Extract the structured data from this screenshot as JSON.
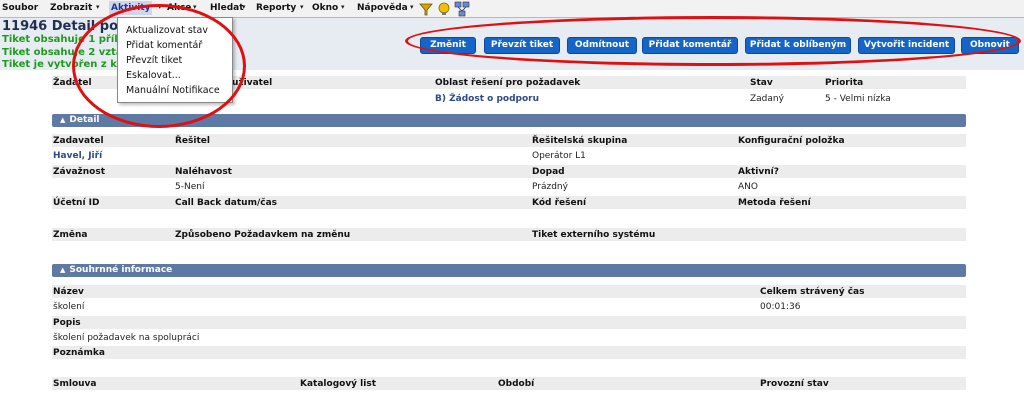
{
  "menu": {
    "items": [
      "Soubor",
      "Zobrazit",
      "Aktivity",
      "Akce",
      "Hledat",
      "Reporty",
      "Okno",
      "Nápověda"
    ]
  },
  "toolbar_icons": [
    "filter-icon",
    "lightbulb-icon",
    "network-icon"
  ],
  "header": {
    "title": "11946 Detail poža",
    "messages": [
      "Tiket obsahuje 1 přílo",
      "Tiket obsahuje 2 vzta",
      "Tiket je vytvořen z ko"
    ]
  },
  "actions": [
    "Změnit",
    "Převzít tiket",
    "Odmítnout",
    "Přidat komentář",
    "Přidat k oblíbeným",
    "Vytvořit incident",
    "Obnovit"
  ],
  "dropdown": {
    "items": [
      "Aktualizovat stav",
      "Přidat komentář",
      "Převzít tiket",
      "Eskalovat...",
      "Manuální Notifikace"
    ]
  },
  "top_section": {
    "labels": [
      "Žadatel",
      "uživatel",
      "Oblast řešení pro požadavek",
      "Stav",
      "Priorita"
    ],
    "values": [
      "B) Žádost o podporu",
      "Zadaný",
      "5 - Velmi nízka"
    ]
  },
  "detail": {
    "title": "Detail",
    "rows": [
      {
        "labels": [
          "Zadavatel",
          "Řešitel",
          "Řešitelská skupina",
          "Konfigurační položka"
        ],
        "values": [
          "Havel, Jiří",
          "",
          "Operátor L1",
          ""
        ]
      },
      {
        "labels": [
          "Závažnost",
          "Naléhavost",
          "Dopad",
          "Aktivní?"
        ],
        "values": [
          "",
          "5-Není",
          "Prázdný",
          "ANO"
        ]
      },
      {
        "labels": [
          "Účetní ID",
          "Call Back datum/čas",
          "Kód řešení",
          "Metoda řešení"
        ],
        "values": [
          "",
          "",
          "",
          ""
        ]
      },
      {
        "labels": [
          "Změna",
          "Způsobeno Požadavkem na změnu",
          "Tiket externího systému",
          ""
        ],
        "values": [
          "",
          "",
          "",
          ""
        ]
      }
    ]
  },
  "summary": {
    "title": "Souhrnné informace",
    "name_label": "Název",
    "name_value": "školení",
    "time_label": "Celkem strávený čas",
    "time_value": "00:01:36",
    "desc_label": "Popis",
    "desc_value": "školení požadavek na spolupráci",
    "note_label": "Poznámka",
    "bottom_labels": [
      "Smlouva",
      "Katalogový list",
      "Období",
      "Provozní stav"
    ]
  }
}
